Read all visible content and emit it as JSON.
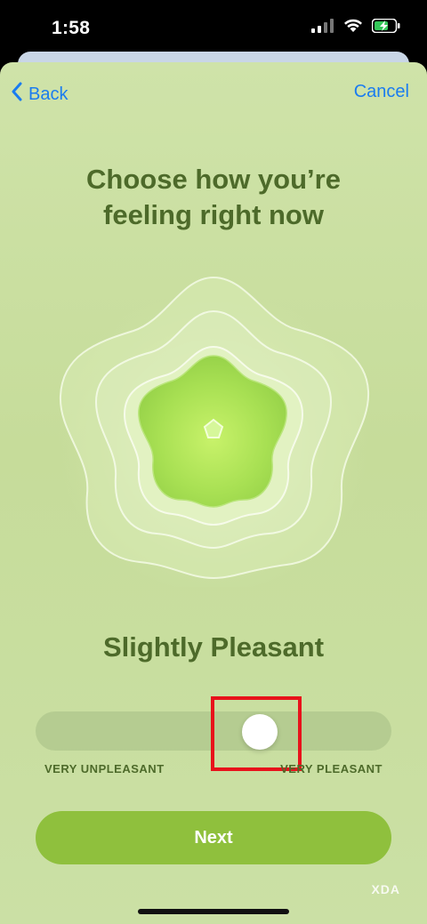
{
  "status_bar": {
    "time": "1:58",
    "signal_icon": "cellular-signal-icon",
    "wifi_icon": "wifi-icon",
    "battery_icon": "battery-charging-icon"
  },
  "nav": {
    "back_label": "Back",
    "back_icon": "chevron-left-icon",
    "cancel_label": "Cancel"
  },
  "main": {
    "title_line1": "Choose how you’re",
    "title_line2": "feeling right now",
    "mood_label": "Slightly Pleasant",
    "illustration_icon": "flower-mood-icon"
  },
  "slider": {
    "min_label": "VERY UNPLEASANT",
    "max_label": "VERY PLEASANT",
    "value_fraction": 0.75
  },
  "footer": {
    "next_label": "Next",
    "watermark": "XDA"
  },
  "colors": {
    "accent": "#1a7cf0",
    "text_green": "#4d6a2a",
    "button_green": "#8fc03d",
    "highlight_red": "#e8121b",
    "background": "#cfe3a9"
  }
}
